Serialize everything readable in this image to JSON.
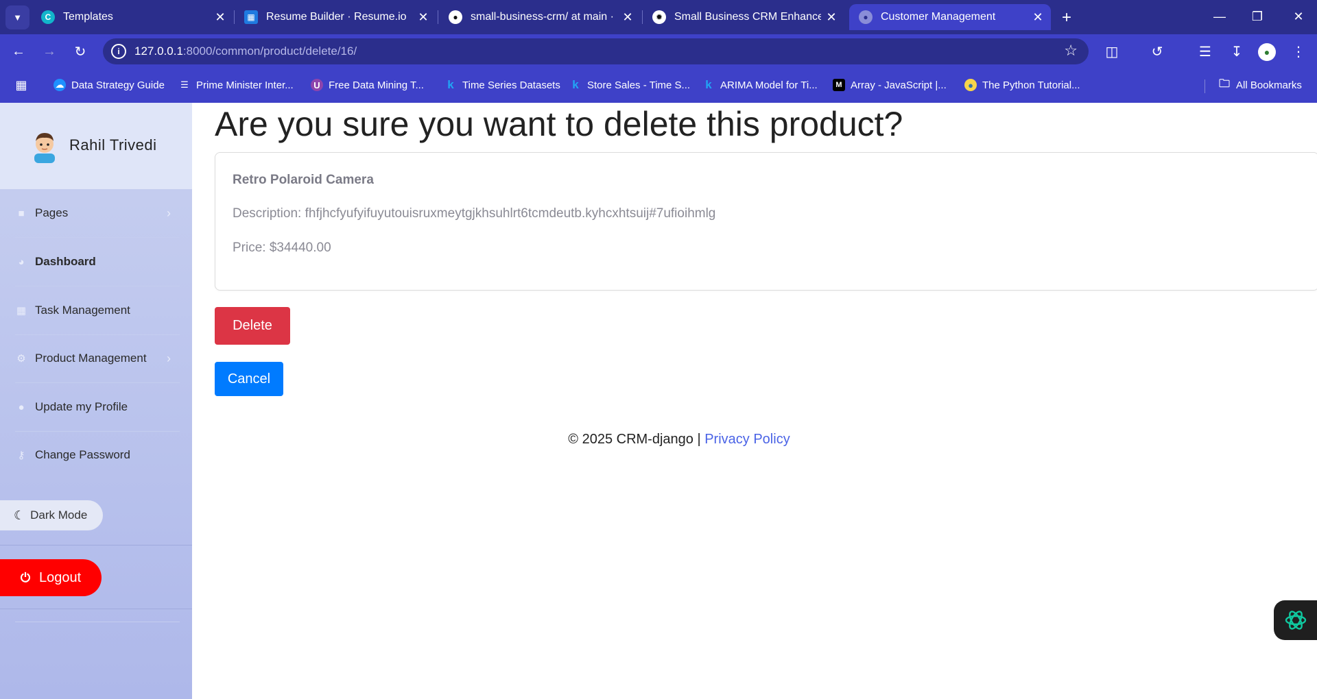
{
  "browser": {
    "tabs": [
      {
        "title": "Templates",
        "active": false
      },
      {
        "title": "Resume Builder · Resume.io",
        "active": false
      },
      {
        "title": "small-business-crm/ at main · ra",
        "active": false
      },
      {
        "title": "Small Business CRM Enhanceme",
        "active": false
      },
      {
        "title": "Customer Management",
        "active": true
      }
    ],
    "url_host": "127.0.0.1",
    "url_path": ":8000/common/product/delete/16/",
    "bookmarks": [
      {
        "label": "Data Strategy Guide"
      },
      {
        "label": "Prime Minister Inter..."
      },
      {
        "label": "Free Data Mining T..."
      },
      {
        "label": "Time Series Datasets"
      },
      {
        "label": "Store Sales - Time S..."
      },
      {
        "label": "ARIMA Model for Ti..."
      },
      {
        "label": "Array - JavaScript |..."
      },
      {
        "label": "The Python Tutorial..."
      }
    ],
    "all_bookmarks": "All Bookmarks"
  },
  "sidebar": {
    "user_name": "Rahil Trivedi",
    "items": [
      {
        "label": "Pages",
        "icon": "folder-icon",
        "has_chevron": true,
        "bold": false
      },
      {
        "label": "Dashboard",
        "icon": "dashboard-icon",
        "has_chevron": false,
        "bold": true
      },
      {
        "label": "Task Management",
        "icon": "calendar-icon",
        "has_chevron": false,
        "bold": false
      },
      {
        "label": "Product Management",
        "icon": "cogs-icon",
        "has_chevron": true,
        "bold": false
      },
      {
        "label": "Update my Profile",
        "icon": "user-icon",
        "has_chevron": false,
        "bold": false
      },
      {
        "label": "Change Password",
        "icon": "key-icon",
        "has_chevron": false,
        "bold": false
      }
    ],
    "dark_mode_label": "Dark Mode",
    "logout_label": "Logout"
  },
  "main": {
    "title": "Are you sure you want to delete this product?",
    "product": {
      "name": "Retro Polaroid Camera",
      "description": "Description: fhfjhcfyufyifuyutouisruxmeytgjkhsuhlrt6tcmdeutb.kyhcxhtsuij#7ufioihmlg",
      "price": "Price: $34440.00"
    },
    "delete_label": "Delete",
    "cancel_label": "Cancel",
    "footer_text": "© 2025 CRM-django | ",
    "footer_link": "Privacy Policy"
  },
  "colors": {
    "browser_dark": "#2b2e8c",
    "browser_accent": "#3e41c8",
    "delete": "#dc3545",
    "cancel": "#007bff",
    "logout": "#ff0000",
    "link": "#4a63e6"
  }
}
